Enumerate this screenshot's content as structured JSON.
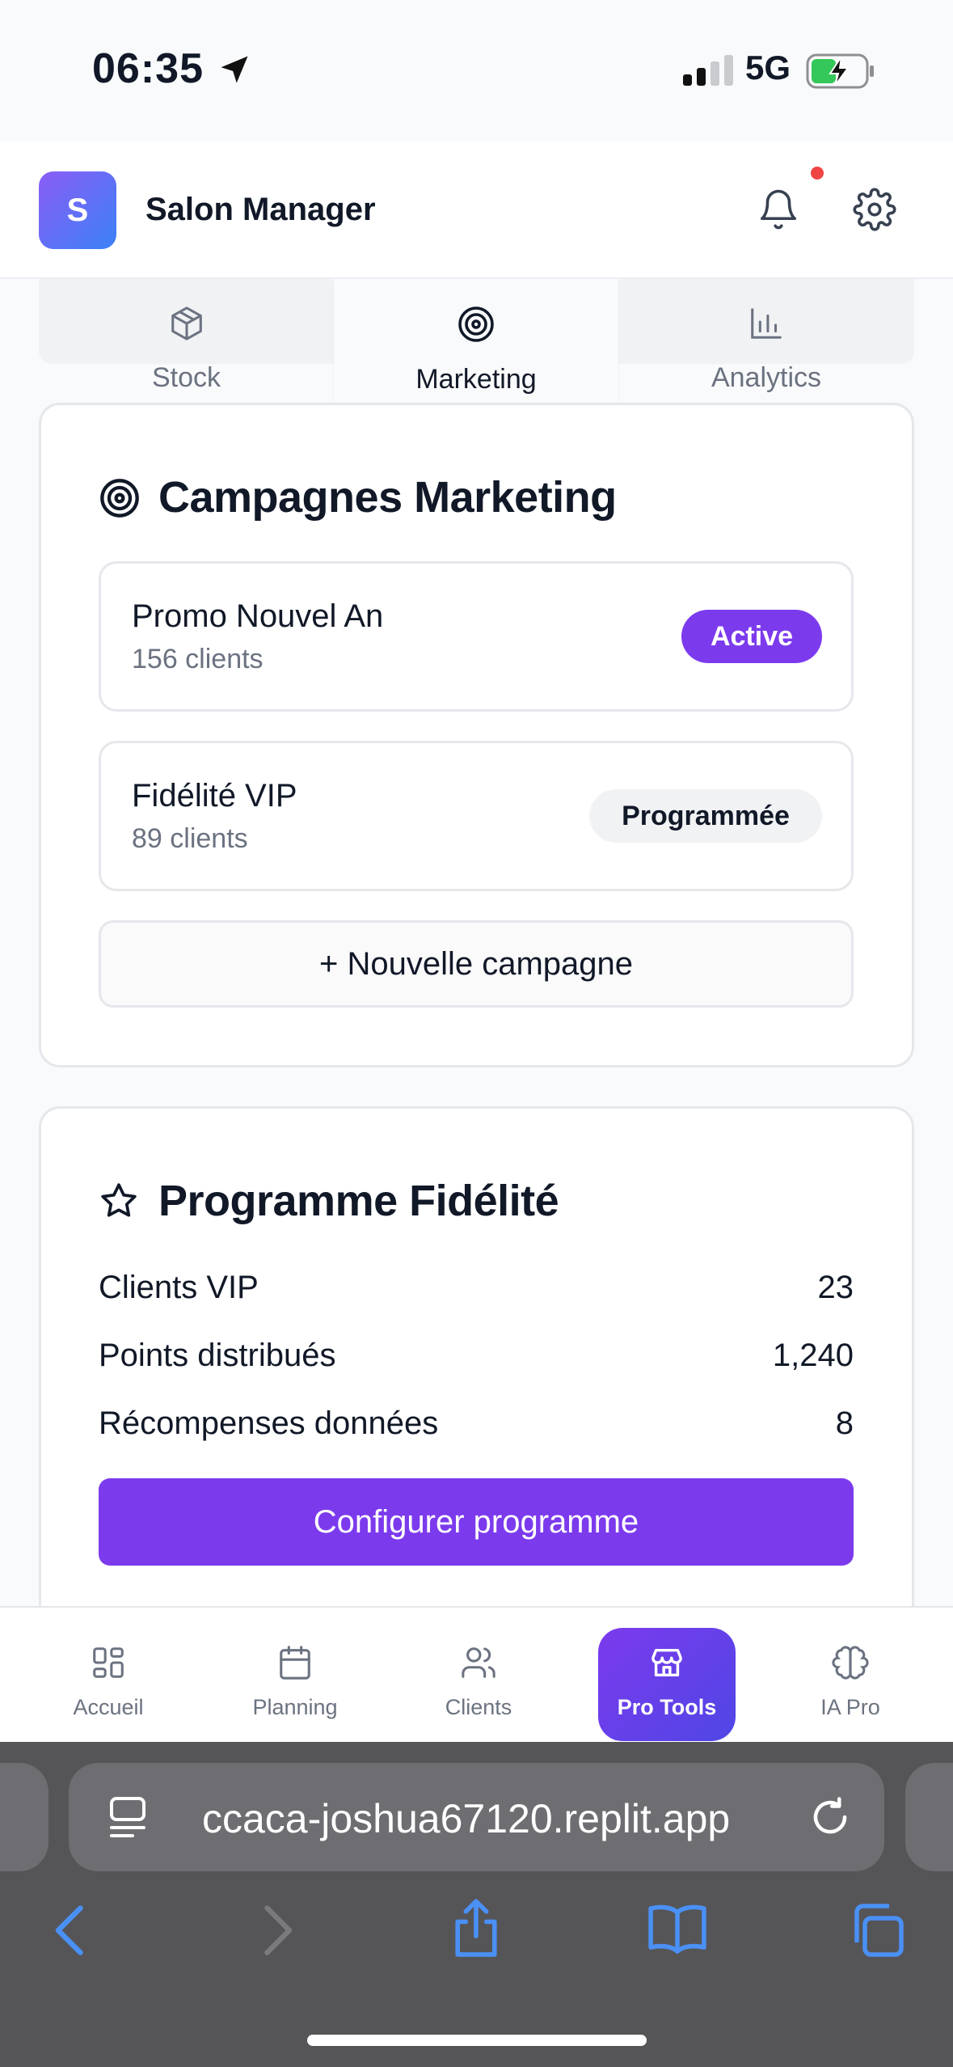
{
  "status_bar": {
    "time": "06:35",
    "network": "5G"
  },
  "header": {
    "logo_letter": "S",
    "title": "Salon Manager"
  },
  "tabs": [
    {
      "label": "Stock",
      "icon": "box-icon"
    },
    {
      "label": "Marketing",
      "icon": "target-icon",
      "active": true
    },
    {
      "label": "Analytics",
      "icon": "bar-chart-icon"
    }
  ],
  "marketing": {
    "title": "Campagnes Marketing",
    "campaigns": [
      {
        "name": "Promo Nouvel An",
        "clients": "156 clients",
        "status": "Active"
      },
      {
        "name": "Fidélité VIP",
        "clients": "89 clients",
        "status": "Programmée"
      }
    ],
    "new_campaign_label": "+ Nouvelle campagne"
  },
  "loyalty": {
    "title": "Programme Fidélité",
    "stats": [
      {
        "label": "Clients VIP",
        "value": "23"
      },
      {
        "label": "Points distribués",
        "value": "1,240"
      },
      {
        "label": "Récompenses données",
        "value": "8"
      }
    ],
    "configure_label": "Configurer programme"
  },
  "bottom_nav": [
    {
      "label": "Accueil",
      "icon": "grid-icon"
    },
    {
      "label": "Planning",
      "icon": "calendar-icon"
    },
    {
      "label": "Clients",
      "icon": "users-icon"
    },
    {
      "label": "Pro Tools",
      "icon": "store-icon",
      "active": true
    },
    {
      "label": "IA Pro",
      "icon": "brain-icon"
    }
  ],
  "browser": {
    "url": "ccaca-joshua67120.replit.app"
  },
  "colors": {
    "accent": "#7c3aed",
    "notification": "#ef4444",
    "battery_charging": "#34c759"
  }
}
